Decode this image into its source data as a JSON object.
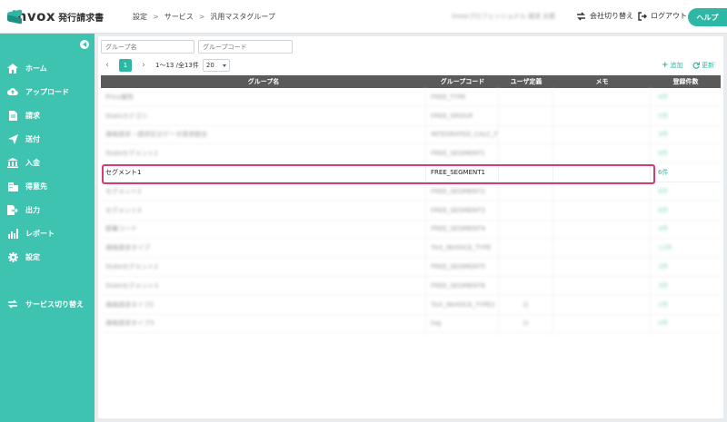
{
  "header": {
    "logo_word": "invox",
    "logo_sub": "発行請求書",
    "breadcrumb": [
      "設定",
      "サービス",
      "汎用マスタグループ"
    ],
    "breadcrumb_sep": ">",
    "org_name": "invoxプロフェッショナル 請求 太郎",
    "switch_company": "会社切り替え",
    "logout": "ログアウト",
    "help": "ヘルプ"
  },
  "sidebar": {
    "items": [
      {
        "label": "ホーム",
        "icon": "home-icon"
      },
      {
        "label": "アップロード",
        "icon": "cloud-upload-icon"
      },
      {
        "label": "請求",
        "icon": "document-icon"
      },
      {
        "label": "送付",
        "icon": "send-icon"
      },
      {
        "label": "入金",
        "icon": "bank-icon"
      },
      {
        "label": "得意先",
        "icon": "building-icon"
      },
      {
        "label": "出力",
        "icon": "export-icon"
      },
      {
        "label": "レポート",
        "icon": "chart-icon"
      },
      {
        "label": "設定",
        "icon": "gear-icon"
      }
    ],
    "service_switch": "サービス切り替え"
  },
  "filters": {
    "group_name_placeholder": "グループ名",
    "group_code_placeholder": "グループコード"
  },
  "pager": {
    "current_page": "1",
    "info": "1〜13 /全13件",
    "page_size": "20"
  },
  "actions": {
    "add": "追加",
    "refresh": "更新"
  },
  "table": {
    "headers": {
      "name": "グループ名",
      "code": "グループコード",
      "user_defined": "ユーザ定義",
      "memo": "メモ",
      "count": "登録件数"
    },
    "rows": [
      {
        "name": "Price属性",
        "code": "FREE_TYPE",
        "user": "",
        "count": "4件",
        "blurred": true
      },
      {
        "name": "Stateカテゴリ",
        "code": "FREE_GROUP",
        "user": "",
        "count": "5件",
        "blurred": true
      },
      {
        "name": "適格請求・請求区分データ請求統合",
        "code": "INTEGRATED_CALC_F",
        "user": "",
        "count": "3件",
        "blurred": true
      },
      {
        "name": "Stateセグメント1",
        "code": "FREE_SEGMENT1",
        "user": "",
        "count": "6件",
        "blurred": true
      },
      {
        "name": "セグメント1",
        "code": "FREE_SEGMENT1",
        "user": "",
        "count": "6件",
        "blurred": false,
        "highlight": true
      },
      {
        "name": "セグメント2",
        "code": "FREE_SEGMENT2",
        "user": "",
        "count": "6件",
        "blurred": true
      },
      {
        "name": "セグメント3",
        "code": "FREE_SEGMENT3",
        "user": "",
        "count": "6件",
        "blurred": true
      },
      {
        "name": "部署コード",
        "code": "FREE_SEGMENT4",
        "user": "",
        "count": "4件",
        "blurred": true
      },
      {
        "name": "適格請求タイプ",
        "code": "TAX_INVOICE_TYPE",
        "user": "",
        "count": "12件",
        "blurred": true
      },
      {
        "name": "Stateセグメント2",
        "code": "FREE_SEGMENT5",
        "user": "",
        "count": "3件",
        "blurred": true
      },
      {
        "name": "Stateセグメント3",
        "code": "FREE_SEGMENT6",
        "user": "",
        "count": "3件",
        "blurred": true
      },
      {
        "name": "適格請求タイプ2",
        "code": "TAX_INVOICE_TYPE2",
        "user": "☑",
        "count": "2件",
        "blurred": true
      },
      {
        "name": "適格請求タイプ3",
        "code": "tag",
        "user": "☑",
        "count": "2件",
        "blurred": true
      }
    ]
  },
  "colors": {
    "accent": "#2fb7a6",
    "sidebar": "#3ec3b0",
    "highlight": "#d93b6a",
    "table_header": "#5a5a5a"
  }
}
